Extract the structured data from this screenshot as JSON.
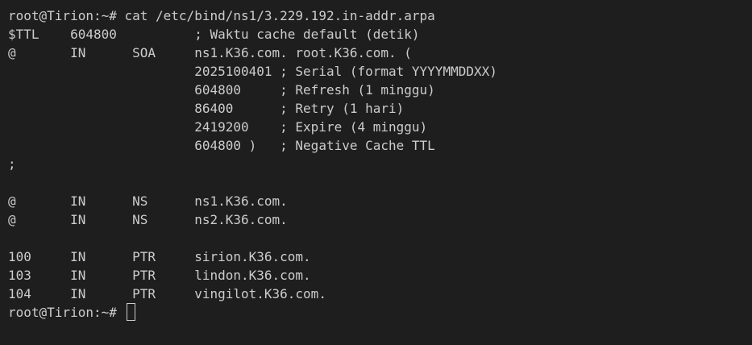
{
  "terminal": {
    "lines": [
      "root@Tirion:~# cat /etc/bind/ns1/3.229.192.in-addr.arpa",
      "$TTL    604800          ; Waktu cache default (detik)",
      "@       IN      SOA     ns1.K36.com. root.K36.com. (",
      "                        2025100401 ; Serial (format YYYYMMDDXX)",
      "                        604800     ; Refresh (1 minggu)",
      "                        86400      ; Retry (1 hari)",
      "                        2419200    ; Expire (4 minggu)",
      "                        604800 )   ; Negative Cache TTL",
      ";",
      "",
      "@       IN      NS      ns1.K36.com.",
      "@       IN      NS      ns2.K36.com.",
      "",
      "100     IN      PTR     sirion.K36.com.",
      "103     IN      PTR     lindon.K36.com.",
      "104     IN      PTR     vingilot.K36.com."
    ],
    "prompt": "root@Tirion:~# "
  }
}
